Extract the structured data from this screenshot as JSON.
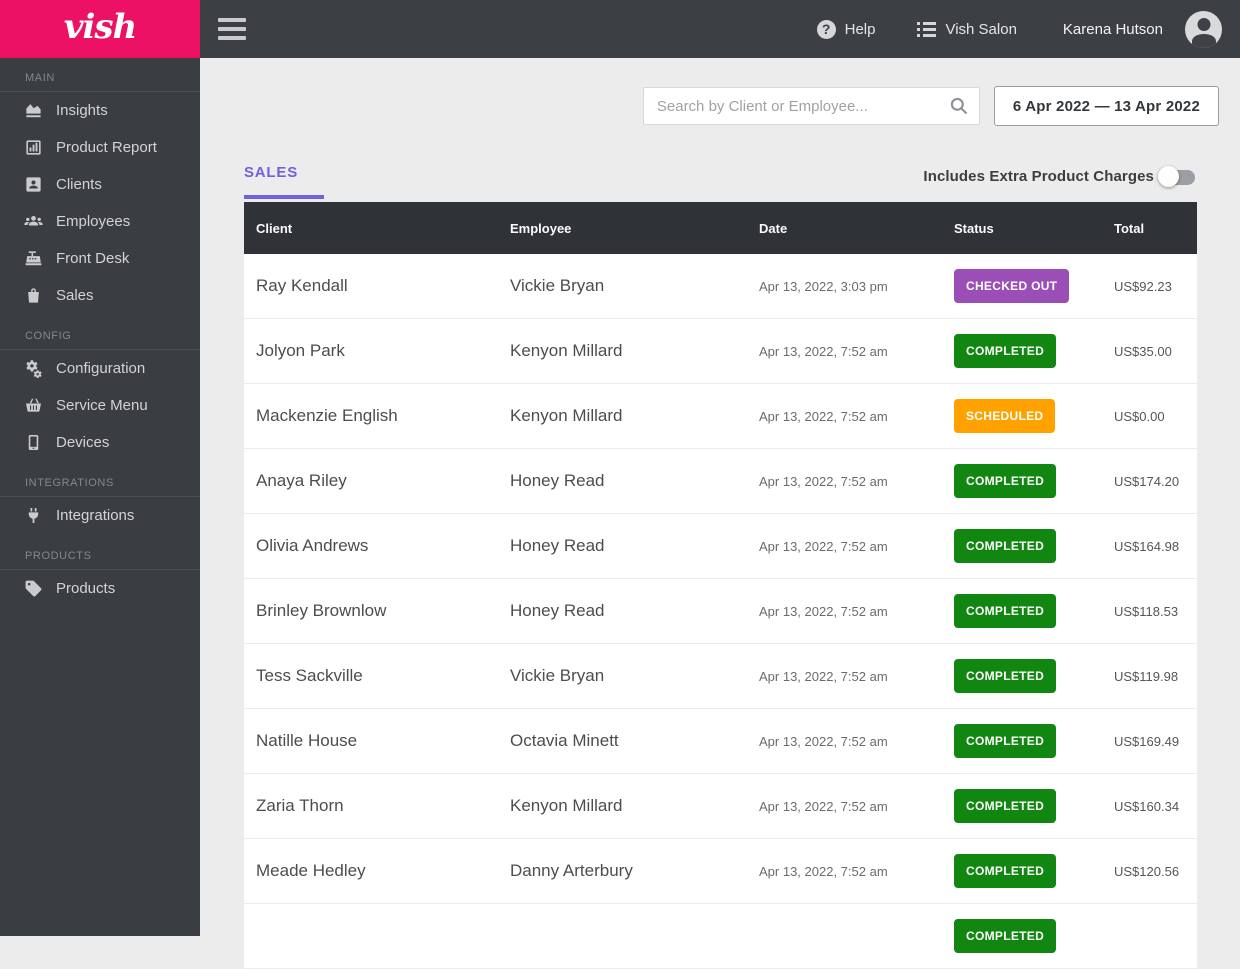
{
  "brand": {
    "logo_text": "vish",
    "color": "#EC1164"
  },
  "header": {
    "help_label": "Help",
    "salon_label": "Vish Salon",
    "user_name": "Karena Hutson"
  },
  "sidebar": {
    "sections": [
      {
        "label": "MAIN",
        "items": [
          {
            "id": "insights",
            "label": "Insights",
            "icon": "area-chart-icon"
          },
          {
            "id": "product-report",
            "label": "Product Report",
            "icon": "bar-chart-icon"
          },
          {
            "id": "clients",
            "label": "Clients",
            "icon": "contact-card-icon"
          },
          {
            "id": "employees",
            "label": "Employees",
            "icon": "people-group-icon"
          },
          {
            "id": "front-desk",
            "label": "Front Desk",
            "icon": "cash-register-icon"
          },
          {
            "id": "sales",
            "label": "Sales",
            "icon": "shopping-bag-icon"
          }
        ]
      },
      {
        "label": "CONFIG",
        "items": [
          {
            "id": "configuration",
            "label": "Configuration",
            "icon": "gears-icon"
          },
          {
            "id": "service-menu",
            "label": "Service Menu",
            "icon": "basket-icon"
          },
          {
            "id": "devices",
            "label": "Devices",
            "icon": "tablet-icon"
          }
        ]
      },
      {
        "label": "INTEGRATIONS",
        "items": [
          {
            "id": "integrations",
            "label": "Integrations",
            "icon": "plug-icon"
          }
        ]
      },
      {
        "label": "PRODUCTS",
        "items": [
          {
            "id": "products",
            "label": "Products",
            "icon": "tag-icon"
          }
        ]
      }
    ]
  },
  "toolbar": {
    "search_placeholder": "Search by Client or Employee...",
    "date_range": "6 Apr 2022 — 13 Apr 2022"
  },
  "tabs": {
    "sales_label": "SALES"
  },
  "toggle": {
    "label": "Includes Extra Product Charges",
    "state": "off"
  },
  "table": {
    "columns": [
      "Client",
      "Employee",
      "Date",
      "Status",
      "Total"
    ],
    "status_colors": {
      "CHECKED OUT": "#9B4EB6",
      "COMPLETED": "#118611",
      "SCHEDULED": "#FFA200"
    },
    "rows": [
      {
        "client": "Ray Kendall",
        "employee": "Vickie Bryan",
        "date": "Apr 13, 2022, 3:03 pm",
        "status": "CHECKED OUT",
        "total": "US$92.23"
      },
      {
        "client": "Jolyon Park",
        "employee": "Kenyon Millard",
        "date": "Apr 13, 2022, 7:52 am",
        "status": "COMPLETED",
        "total": "US$35.00"
      },
      {
        "client": "Mackenzie English",
        "employee": "Kenyon Millard",
        "date": "Apr 13, 2022, 7:52 am",
        "status": "SCHEDULED",
        "total": "US$0.00"
      },
      {
        "client": "Anaya Riley",
        "employee": "Honey Read",
        "date": "Apr 13, 2022, 7:52 am",
        "status": "COMPLETED",
        "total": "US$174.20"
      },
      {
        "client": "Olivia Andrews",
        "employee": "Honey Read",
        "date": "Apr 13, 2022, 7:52 am",
        "status": "COMPLETED",
        "total": "US$164.98"
      },
      {
        "client": "Brinley Brownlow",
        "employee": "Honey Read",
        "date": "Apr 13, 2022, 7:52 am",
        "status": "COMPLETED",
        "total": "US$118.53"
      },
      {
        "client": "Tess Sackville",
        "employee": "Vickie Bryan",
        "date": "Apr 13, 2022, 7:52 am",
        "status": "COMPLETED",
        "total": "US$119.98"
      },
      {
        "client": "Natille House",
        "employee": "Octavia Minett",
        "date": "Apr 13, 2022, 7:52 am",
        "status": "COMPLETED",
        "total": "US$169.49"
      },
      {
        "client": "Zaria Thorn",
        "employee": "Kenyon Millard",
        "date": "Apr 13, 2022, 7:52 am",
        "status": "COMPLETED",
        "total": "US$160.34"
      },
      {
        "client": "Meade Hedley",
        "employee": "Danny Arterbury",
        "date": "Apr 13, 2022, 7:52 am",
        "status": "COMPLETED",
        "total": "US$120.56"
      },
      {
        "client": "",
        "employee": "",
        "date": "",
        "status": "COMPLETED",
        "total": ""
      }
    ]
  }
}
